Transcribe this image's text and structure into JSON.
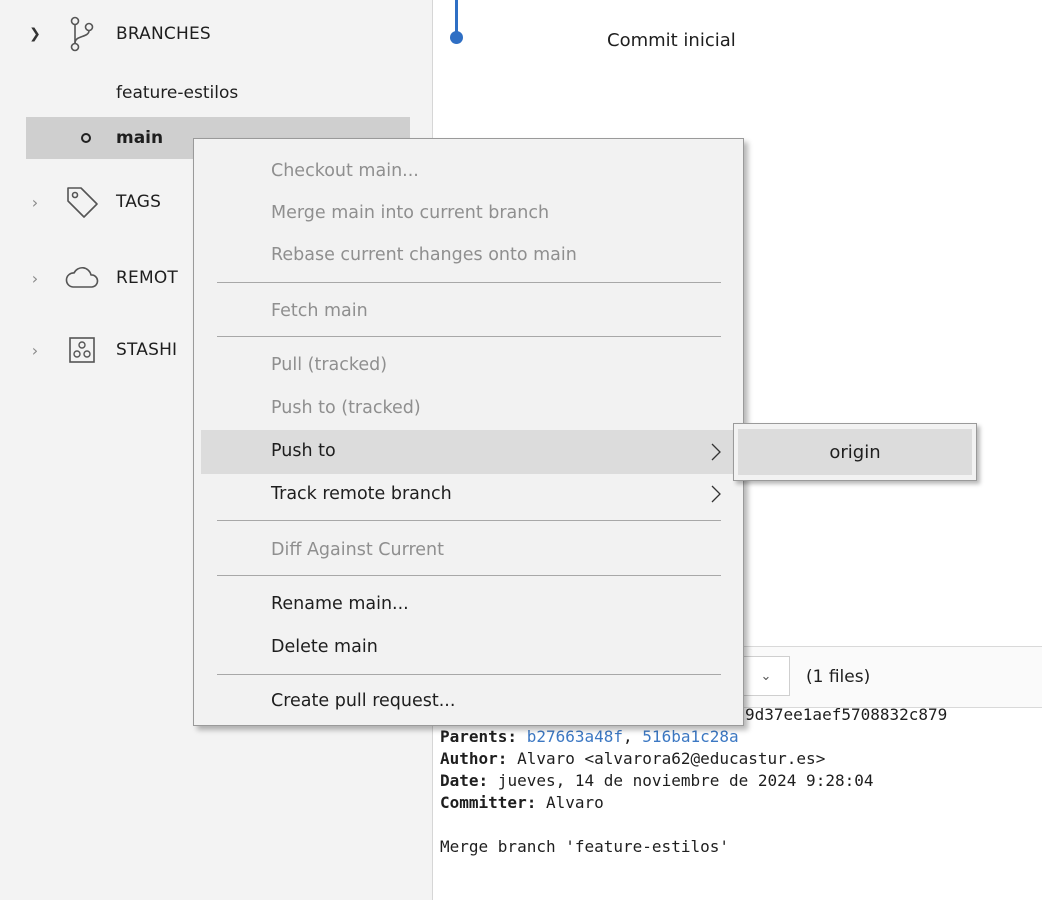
{
  "sidebar": {
    "branches_label": "BRANCHES",
    "branches": [
      {
        "name": "feature-estilos"
      },
      {
        "name": "main"
      }
    ],
    "tags_label": "TAGS",
    "remotes_label": "REMOT",
    "stashes_label": "STASHI"
  },
  "graph": {
    "commit_message": "Commit inicial"
  },
  "context_menu": {
    "items": [
      {
        "label": "Checkout main...",
        "enabled": false
      },
      {
        "label": "Merge main into current branch",
        "enabled": false
      },
      {
        "label": "Rebase current changes onto main",
        "enabled": false
      },
      {
        "label": "Fetch main",
        "enabled": false
      },
      {
        "label": "Pull  (tracked)",
        "enabled": false
      },
      {
        "label": "Push to  (tracked)",
        "enabled": false
      },
      {
        "label": "Push to",
        "enabled": true,
        "has_submenu": true,
        "highlighted": true
      },
      {
        "label": "Track remote branch",
        "enabled": true,
        "has_submenu": true
      },
      {
        "label": "Diff Against Current",
        "enabled": false
      },
      {
        "label": "Rename main...",
        "enabled": true
      },
      {
        "label": "Delete main",
        "enabled": true
      },
      {
        "label": "Create pull request...",
        "enabled": true
      }
    ],
    "submenu": {
      "items": [
        {
          "label": "origin"
        }
      ]
    }
  },
  "details": {
    "files_count": "(1 files)",
    "commit_hash_partial": "9d37ee1aef5708832c879",
    "parents_label": "Parents:",
    "parent1": "b27663a48f",
    "parents_separator": ", ",
    "parent2": "516ba1c28a",
    "author_label": "Author:",
    "author_value": " Alvaro <alvarora62@educastur.es>",
    "date_label": "Date:",
    "date_value": " jueves, 14 de noviembre de 2024 9:28:04",
    "committer_label": "Committer:",
    "committer_value": " Alvaro",
    "message": "Merge branch 'feature-estilos'"
  },
  "colors": {
    "graph_accent": "#2f6fc4",
    "link": "#3c78c3",
    "menu_highlight": "#dcdcdc",
    "sidebar_selected": "#cfcfcf"
  }
}
